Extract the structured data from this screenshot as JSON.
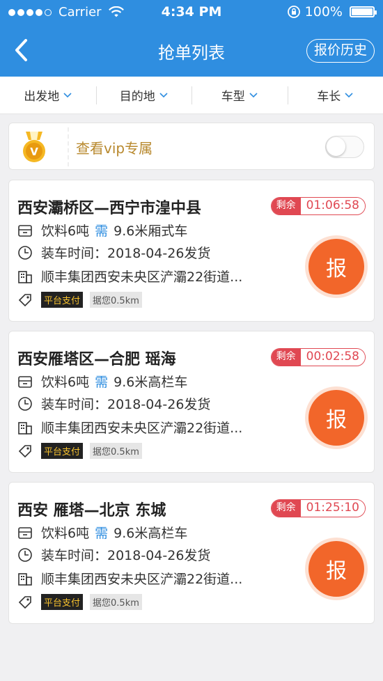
{
  "status_bar": {
    "carrier": "Carrier",
    "time": "4:34 PM",
    "battery": "100%"
  },
  "nav": {
    "title": "抢单列表",
    "history_label": "报价历史"
  },
  "filters": [
    {
      "label": "出发地"
    },
    {
      "label": "目的地"
    },
    {
      "label": "车型"
    },
    {
      "label": "车长"
    }
  ],
  "vip": {
    "badge_letter": "V",
    "text": "查看vip专属",
    "toggle_on": false
  },
  "orders": [
    {
      "route": "西安灞桥区—西宁市湟中县",
      "remain_label": "剩余",
      "remain_time": "01:06:58",
      "cargo": "饮料6吨",
      "need_label": "需",
      "truck": "9.6米厢式车",
      "load_time": "装车时间：2018-04-26发货",
      "company": "顺丰集团西安未央区浐灞22街道...",
      "pay_tag": "平台支付",
      "distance": "据您0.5km",
      "bid_label": "报"
    },
    {
      "route": "西安雁塔区—合肥 瑶海",
      "remain_label": "剩余",
      "remain_time": "00:02:58",
      "cargo": "饮料6吨",
      "need_label": "需",
      "truck": "9.6米高栏车",
      "load_time": "装车时间：2018-04-26发货",
      "company": "顺丰集团西安未央区浐灞22街道...",
      "pay_tag": "平台支付",
      "distance": "据您0.5km",
      "bid_label": "报"
    },
    {
      "route": "西安 雁塔—北京 东城",
      "remain_label": "剩余",
      "remain_time": "01:25:10",
      "cargo": "饮料6吨",
      "need_label": "需",
      "truck": "9.6米高栏车",
      "load_time": "装车时间：2018-04-26发货",
      "company": "顺丰集团西安未央区浐灞22街道...",
      "pay_tag": "平台支付",
      "distance": "据您0.5km",
      "bid_label": "报"
    }
  ],
  "colors": {
    "header": "#2f8ee0",
    "accent_orange": "#f2662a",
    "timer_red": "#e04852",
    "vip_gold": "#b8892e"
  }
}
